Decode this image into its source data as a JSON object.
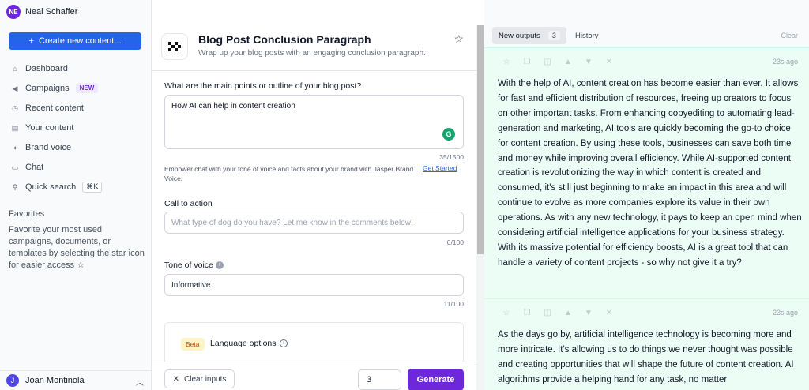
{
  "workspace": {
    "initials": "NE",
    "name": "Neal Schaffer"
  },
  "sidebar": {
    "create_label": "Create new content...",
    "items": [
      {
        "label": "Dashboard",
        "icon": "home-icon"
      },
      {
        "label": "Campaigns",
        "icon": "megaphone-icon",
        "badge": "NEW"
      },
      {
        "label": "Recent content",
        "icon": "clock-icon"
      },
      {
        "label": "Your content",
        "icon": "document-icon"
      },
      {
        "label": "Brand voice",
        "icon": "speaker-icon"
      },
      {
        "label": "Chat",
        "icon": "chat-icon"
      },
      {
        "label": "Quick search",
        "icon": "search-icon",
        "shortcut": "⌘K"
      }
    ],
    "favorites_title": "Favorites",
    "favorites_text": "Favorite your most used campaigns, documents, or templates by selecting the star icon for easier access",
    "user_initial": "J",
    "user_name": "Joan Montinola"
  },
  "template": {
    "title": "Blog Post Conclusion Paragraph",
    "subtitle": "Wrap up your blog posts with an engaging conclusion paragraph."
  },
  "form": {
    "outline_label": "What are the main points or outline of your blog post?",
    "outline_value": "How AI can help in content creation",
    "outline_count": "35/1500",
    "hint": "Empower chat with your tone of voice and facts about your brand with Jasper Brand Voice.",
    "get_started": "Get Started",
    "cta_label": "Call to action",
    "cta_placeholder": "What type of dog do you have? Let me know in the comments below!",
    "cta_count": "0/100",
    "tone_label": "Tone of voice",
    "tone_value": "Informative",
    "tone_count": "11/100",
    "beta": "Beta",
    "language_label": "Language options",
    "clear_label": "Clear inputs",
    "output_count": "3",
    "generate_label": "Generate"
  },
  "outputs": {
    "tab_new": "New outputs",
    "tab_new_count": "3",
    "tab_history": "History",
    "clear": "Clear",
    "cards": [
      {
        "time": "23s ago",
        "text": "With the help of AI, content creation has become easier than ever. It allows for fast and efficient distribution of resources, freeing up creators to focus on other important tasks. From enhancing copyediting to automating lead-generation and marketing, AI tools are quickly becoming the go-to choice for content creation. By using these tools, businesses can save both time and money while improving overall efficiency. While AI-supported content creation is revolutionizing the way in which content is created and consumed, it's still just beginning to make an impact in this area and will continue to evolve as more companies explore its value in their own operations. As with any new technology, it pays to keep an open mind when considering artificial intelligence applications for your business strategy. With its massive potential for efficiency boosts, AI is a great tool that can handle a variety of content projects - so why not give it a try?"
      },
      {
        "time": "23s ago",
        "text": "As the days go by, artificial intelligence technology is becoming more and more intricate. It's allowing us to do things we never thought was possible and creating opportunities that will shape the future of content creation. AI algorithms provide a helping hand for any task, no matter"
      }
    ]
  }
}
